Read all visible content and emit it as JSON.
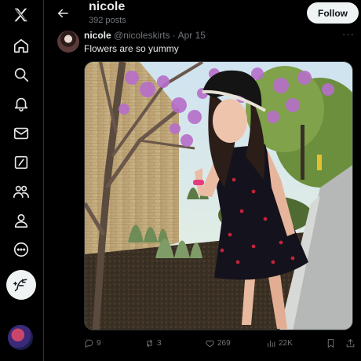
{
  "header": {
    "name": "nicole",
    "post_count": "392 posts",
    "follow_label": "Follow"
  },
  "sidebar": {
    "items": [
      {
        "icon": "x-logo-icon"
      },
      {
        "icon": "home-icon"
      },
      {
        "icon": "search-icon"
      },
      {
        "icon": "notifications-icon"
      },
      {
        "icon": "messages-icon"
      },
      {
        "icon": "grok-icon"
      },
      {
        "icon": "communities-icon"
      },
      {
        "icon": "profile-icon"
      },
      {
        "icon": "more-icon"
      }
    ],
    "post_button_icon": "feather-icon"
  },
  "tweet": {
    "display_name": "nicole",
    "handle": "@nicoleskirts",
    "separator": "·",
    "date": "Apr 15",
    "text": "Flowers are so yummy",
    "more": "···",
    "replies": "9",
    "reposts": "3",
    "likes": "269",
    "views": "22K"
  },
  "colors": {
    "background": "#000000",
    "text": "#e7e9ea",
    "muted": "#71767b",
    "border": "#2f3336",
    "follow_bg": "#eff3f4"
  }
}
